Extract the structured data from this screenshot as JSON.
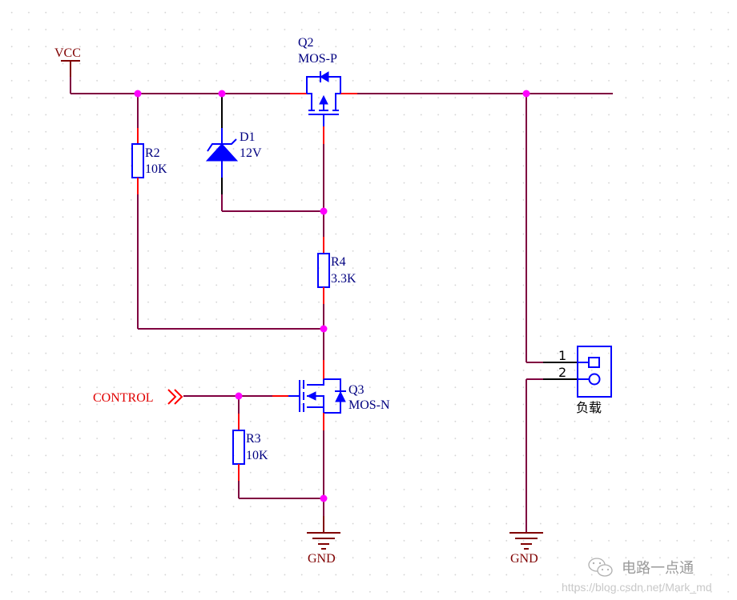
{
  "diagram": {
    "type": "schematic",
    "theme": {
      "wire_color": "#800040",
      "pin_color": "#ff0000",
      "component_color": "#0000ff",
      "junction_color": "#ff00ff",
      "label_color": "#000080",
      "power_color": "#800000",
      "port_color": "#e00000"
    },
    "power": {
      "vcc": "VCC",
      "gnd_left": "GND",
      "gnd_right": "GND"
    },
    "components": {
      "q2": {
        "designator": "Q2",
        "value": "MOS-P"
      },
      "d1": {
        "designator": "D1",
        "value": "12V"
      },
      "r2": {
        "designator": "R2",
        "value": "10K"
      },
      "r4": {
        "designator": "R4",
        "value": "3.3K"
      },
      "q3": {
        "designator": "Q3",
        "value": "MOS-N"
      },
      "r3": {
        "designator": "R3",
        "value": "10K"
      },
      "load": {
        "label": "负载",
        "pin1": "1",
        "pin2": "2"
      }
    },
    "ports": {
      "control": "CONTROL"
    },
    "watermark": {
      "brand": "电路一点通",
      "url": "https://blog.csdn.net/Mark_md"
    }
  }
}
